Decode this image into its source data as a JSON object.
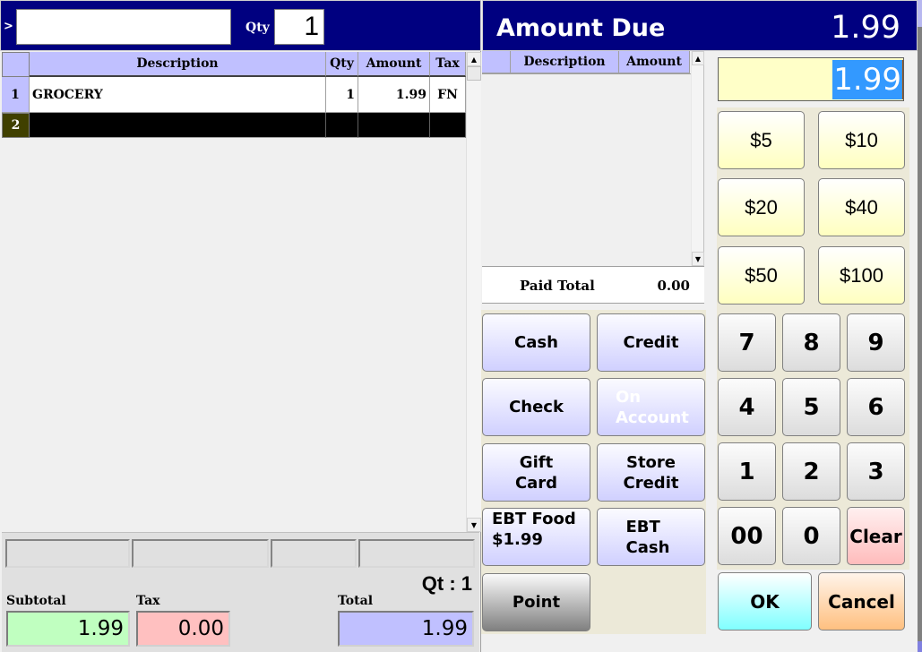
{
  "scan": {
    "prompt_symbol": ">",
    "input_value": "",
    "qty_label": "Qty",
    "qty_value": "1"
  },
  "items_grid": {
    "columns": [
      "Description",
      "Qty",
      "Amount",
      "Tax"
    ],
    "rows": [
      {
        "row_num": "1",
        "description": "GROCERY",
        "qty": "1",
        "amount": "1.99",
        "tax": "FN"
      },
      {
        "row_num": "2",
        "description": "",
        "qty": "",
        "amount": "",
        "tax": ""
      }
    ],
    "scroll_up_icon": "▲",
    "scroll_down_icon": "▼"
  },
  "footer": {
    "qt_label": "Qt : 1",
    "subtotal_label": "Subtotal",
    "subtotal_value": "1.99",
    "tax_label": "Tax",
    "tax_value": "0.00",
    "total_label": "Total",
    "total_value": "1.99"
  },
  "amount_due": {
    "title": "Amount Due",
    "value": "1.99"
  },
  "payments_grid": {
    "columns": [
      "Description",
      "Amount"
    ],
    "rows": [],
    "paid_total_label": "Paid Total",
    "paid_total_value": "0.00"
  },
  "tender_input": {
    "value": "1.99",
    "selected": true
  },
  "payment_buttons": {
    "cash": "Cash",
    "credit": "Credit",
    "check": "Check",
    "on_account": "On Account",
    "gift_card": "Gift Card",
    "store_credit": "Store Credit",
    "ebt_food_line1": "EBT Food",
    "ebt_food_line2": "$1.99",
    "ebt_cash": "EBT Cash",
    "point": "Point"
  },
  "quick_cash": [
    "$5",
    "$10",
    "$20",
    "$40",
    "$50",
    "$100"
  ],
  "keypad": {
    "keys": [
      "7",
      "8",
      "9",
      "4",
      "5",
      "6",
      "1",
      "2",
      "3",
      "00",
      "0"
    ],
    "clear": "Clear",
    "ok": "OK",
    "cancel": "Cancel"
  },
  "colors": {
    "header_navy": "#000080",
    "grid_header": "#c0c0ff",
    "subtotal_bg": "#c0ffc0",
    "tax_bg": "#ffc0c0",
    "total_bg": "#c0c0ff",
    "tender_input_bg": "#ffffc8",
    "selection": "#3399ff"
  }
}
